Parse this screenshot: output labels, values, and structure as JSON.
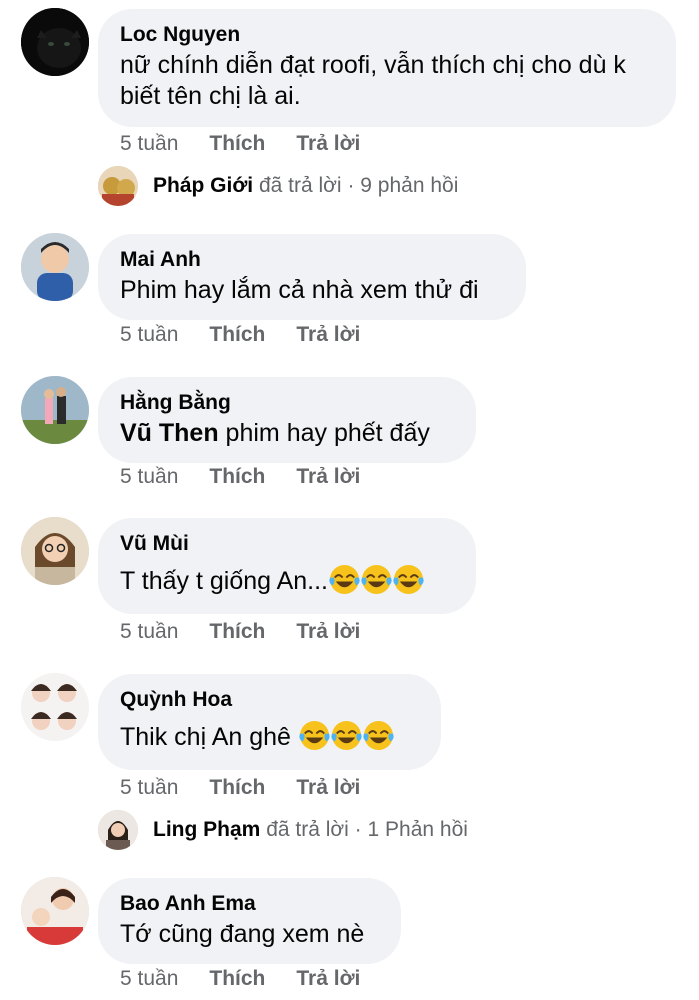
{
  "comments": [
    {
      "author": "Loc Nguyen",
      "text": "nữ chính diễn đạt roofi, vẫn thích chị cho dù k biết tên chị là ai.",
      "time": "5 tuần",
      "like": "Thích",
      "reply": "Trả lời",
      "replies": {
        "name": "Pháp Giới",
        "action": "đã trả lời",
        "sep": "·",
        "count": "9 phản hồi"
      }
    },
    {
      "author": "Mai Anh",
      "text": "Phim hay lắm cả nhà xem thử đi",
      "time": "5 tuần",
      "like": "Thích",
      "reply": "Trả lời"
    },
    {
      "author": "Hằng Bằng",
      "tag": "Vũ Then",
      "text": " phim hay phết đấy",
      "time": "5 tuần",
      "like": "Thích",
      "reply": "Trả lời"
    },
    {
      "author": "Vũ Mùi",
      "text": "T thấy t giống An...",
      "emoji": "face-with-tears-of-joy-emoji",
      "time": "5 tuần",
      "like": "Thích",
      "reply": "Trả lời"
    },
    {
      "author": "Quỳnh Hoa",
      "text": "Thik chị An ghê ",
      "emoji": "face-with-tears-of-joy-emoji",
      "time": "5 tuần",
      "like": "Thích",
      "reply": "Trả lời",
      "replies": {
        "name": "Ling Phạm",
        "action": "đã trả lời",
        "sep": "·",
        "count": "1 Phản hồi"
      }
    },
    {
      "author": "Bao Anh Ema",
      "text": "Tớ cũng đang xem nè",
      "time": "5 tuần",
      "like": "Thích",
      "reply": "Trả lời"
    }
  ],
  "colors": {
    "bubble": "#f0f2f5",
    "meta_text": "#65676b",
    "primary_text": "#050505",
    "background": "#ffffff"
  }
}
